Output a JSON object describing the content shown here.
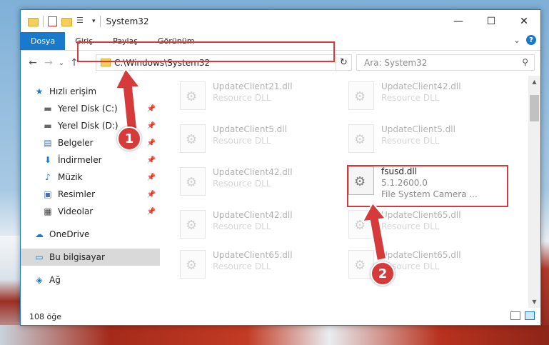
{
  "window": {
    "title": "System32",
    "controls": {
      "minimize": "—",
      "maximize": "☐",
      "close": "✕"
    }
  },
  "ribbon": {
    "tabs": [
      "Dosya",
      "Giriş",
      "Paylaş",
      "Görünüm"
    ],
    "help": "?",
    "expand": "⌄"
  },
  "nav": {
    "back": "←",
    "forward": "→",
    "recent": "⌄",
    "up": "↑",
    "address": "C:\\Windows\\System32",
    "refresh": "↻",
    "search_placeholder": "Ara: System32"
  },
  "sidebar": {
    "items": [
      {
        "label": "Hızlı erişim",
        "icon": "★",
        "icon_name": "star-icon"
      },
      {
        "label": "Yerel Disk (C:)",
        "icon": "▬",
        "icon_name": "drive-icon"
      },
      {
        "label": "Yerel Disk (D:)",
        "icon": "▬",
        "icon_name": "drive-icon"
      },
      {
        "label": "Belgeler",
        "icon": "▤",
        "icon_name": "documents-icon"
      },
      {
        "label": "İndirmeler",
        "icon": "⬇",
        "icon_name": "downloads-icon"
      },
      {
        "label": "Müzik",
        "icon": "♪",
        "icon_name": "music-icon"
      },
      {
        "label": "Resimler",
        "icon": "▣",
        "icon_name": "pictures-icon"
      },
      {
        "label": "Videolar",
        "icon": "▦",
        "icon_name": "videos-icon"
      },
      {
        "label": "OneDrive",
        "icon": "☁",
        "icon_name": "cloud-icon"
      },
      {
        "label": "Bu bilgisayar",
        "icon": "▭",
        "icon_name": "computer-icon"
      },
      {
        "label": "Ağ",
        "icon": "◈",
        "icon_name": "network-icon"
      }
    ]
  },
  "files": [
    {
      "name": "UpdateClient21.dll",
      "sub": "Resource DLL"
    },
    {
      "name": "UpdateClient42.dll",
      "sub": "Resource DLL"
    },
    {
      "name": "UpdateClient5.dll",
      "sub": "Resource DLL"
    },
    {
      "name": "UpdateClient5.dll",
      "sub": "Resource DLL"
    },
    {
      "name": "UpdateClient42.dll",
      "sub": "Resource DLL"
    },
    {
      "name": "fsusd.dll",
      "version": "5.1.2600.0",
      "sub": "File System Camera ..."
    },
    {
      "name": "UpdateClient42.dll",
      "sub": "Resource DLL"
    },
    {
      "name": "UpdateClient65.dll",
      "sub": "Resource DLL"
    },
    {
      "name": "UpdateClient65.dll",
      "sub": "Resource DLL"
    },
    {
      "name": "UpdateClient65.dll",
      "sub": "Resource DLL"
    }
  ],
  "status": {
    "count": "108 öğe"
  },
  "annotations": {
    "step1": "1",
    "step2": "2"
  },
  "colors": {
    "accent": "#1979ca",
    "highlight": "#d53b3b"
  }
}
